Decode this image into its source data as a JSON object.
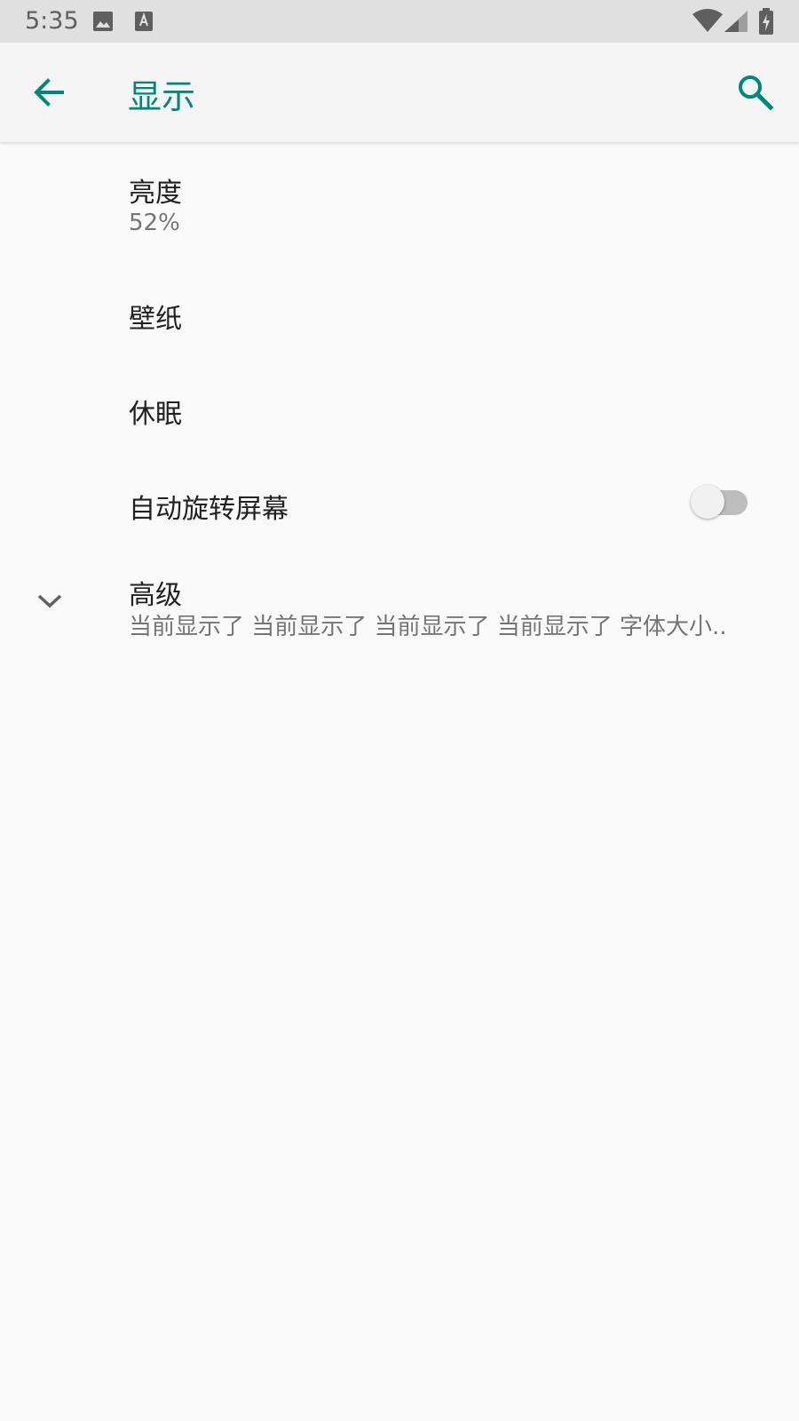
{
  "status_bar": {
    "time": "5:35",
    "icons": [
      "image-icon",
      "font-a-icon",
      "wifi-icon",
      "signal-icon",
      "battery-charging-icon"
    ]
  },
  "app_bar": {
    "title": "显示",
    "back_icon": "arrow-back-icon",
    "search_icon": "search-icon"
  },
  "settings": {
    "brightness": {
      "title": "亮度",
      "summary": "52%"
    },
    "wallpaper": {
      "title": "壁纸"
    },
    "sleep": {
      "title": "休眠"
    },
    "auto_rotate": {
      "title": "自动旋转屏幕",
      "enabled": false
    },
    "advanced": {
      "title": "高级",
      "summary": "当前显示了 当前显示了 当前显示了 当前显示了 字体大小..",
      "icon": "chevron-down-icon"
    }
  },
  "colors": {
    "accent": "#00897b",
    "status_bar_bg": "#e0e0e0",
    "app_bar_bg": "#f5f5f5",
    "background": "#fafafa",
    "primary_text": "#212121",
    "secondary_text": "#757575"
  }
}
